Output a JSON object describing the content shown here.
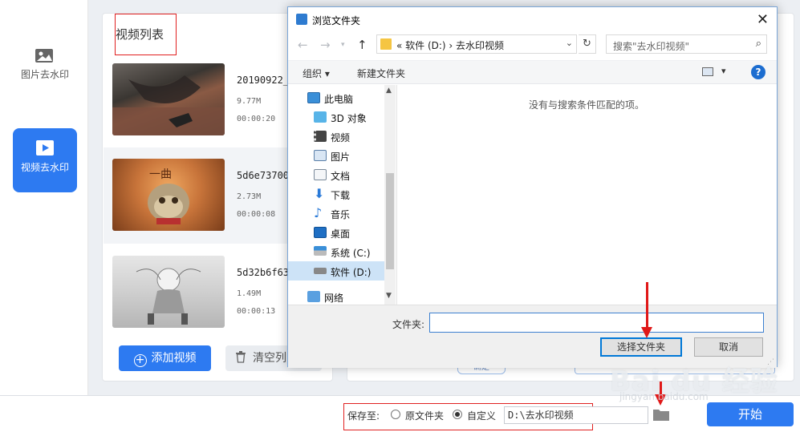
{
  "sidebar": {
    "items": [
      {
        "label": "图片去水印",
        "icon": "image-icon"
      },
      {
        "label": "视频去水印",
        "icon": "play-video-icon"
      }
    ]
  },
  "video_list": {
    "title": "视频列表",
    "items": [
      {
        "name": "20190922_",
        "size": "9.77M",
        "duration": "00:00:20"
      },
      {
        "name": "5d6e73700",
        "size": "2.73M",
        "duration": "00:00:08"
      },
      {
        "name": "5d32b6f63",
        "size": "1.49M",
        "duration": "00:00:13"
      }
    ],
    "add_label": "添加视频",
    "clear_label": "清空列"
  },
  "right_panel": {
    "confirm_label": "确定"
  },
  "bottom": {
    "save_to_label": "保存至:",
    "option_source": "原文件夹",
    "option_custom": "自定义",
    "path_value": "D:\\去水印视频",
    "start_label": "开始"
  },
  "dialog": {
    "title": "浏览文件夹",
    "address": {
      "crumbs": "«  软件 (D:)  ›  去水印视频"
    },
    "search_placeholder": "搜索\"去水印视频\"",
    "toolbar": {
      "organize": "组织 ▾",
      "new_folder": "新建文件夹"
    },
    "tree": [
      {
        "label": "此电脑",
        "icon": "this-pc-icon"
      },
      {
        "label": "3D 对象",
        "icon": "3d-objects-icon"
      },
      {
        "label": "视频",
        "icon": "videos-folder-icon"
      },
      {
        "label": "图片",
        "icon": "pictures-folder-icon"
      },
      {
        "label": "文档",
        "icon": "documents-folder-icon"
      },
      {
        "label": "下载",
        "icon": "downloads-folder-icon"
      },
      {
        "label": "音乐",
        "icon": "music-folder-icon"
      },
      {
        "label": "桌面",
        "icon": "desktop-folder-icon"
      },
      {
        "label": "系统 (C:)",
        "icon": "system-drive-icon"
      },
      {
        "label": "软件 (D:)",
        "icon": "drive-icon"
      },
      {
        "label": "网络",
        "icon": "network-icon"
      }
    ],
    "empty_message": "没有与搜索条件匹配的项。",
    "folder_label": "文件夹:",
    "folder_value": "",
    "select_label": "选择文件夹",
    "cancel_label": "取消"
  },
  "watermark": {
    "text": "Bai du 经验",
    "sub": "jingyan.baidu.com"
  },
  "colors": {
    "accent": "#2d7af1",
    "annotation": "#e02020"
  }
}
